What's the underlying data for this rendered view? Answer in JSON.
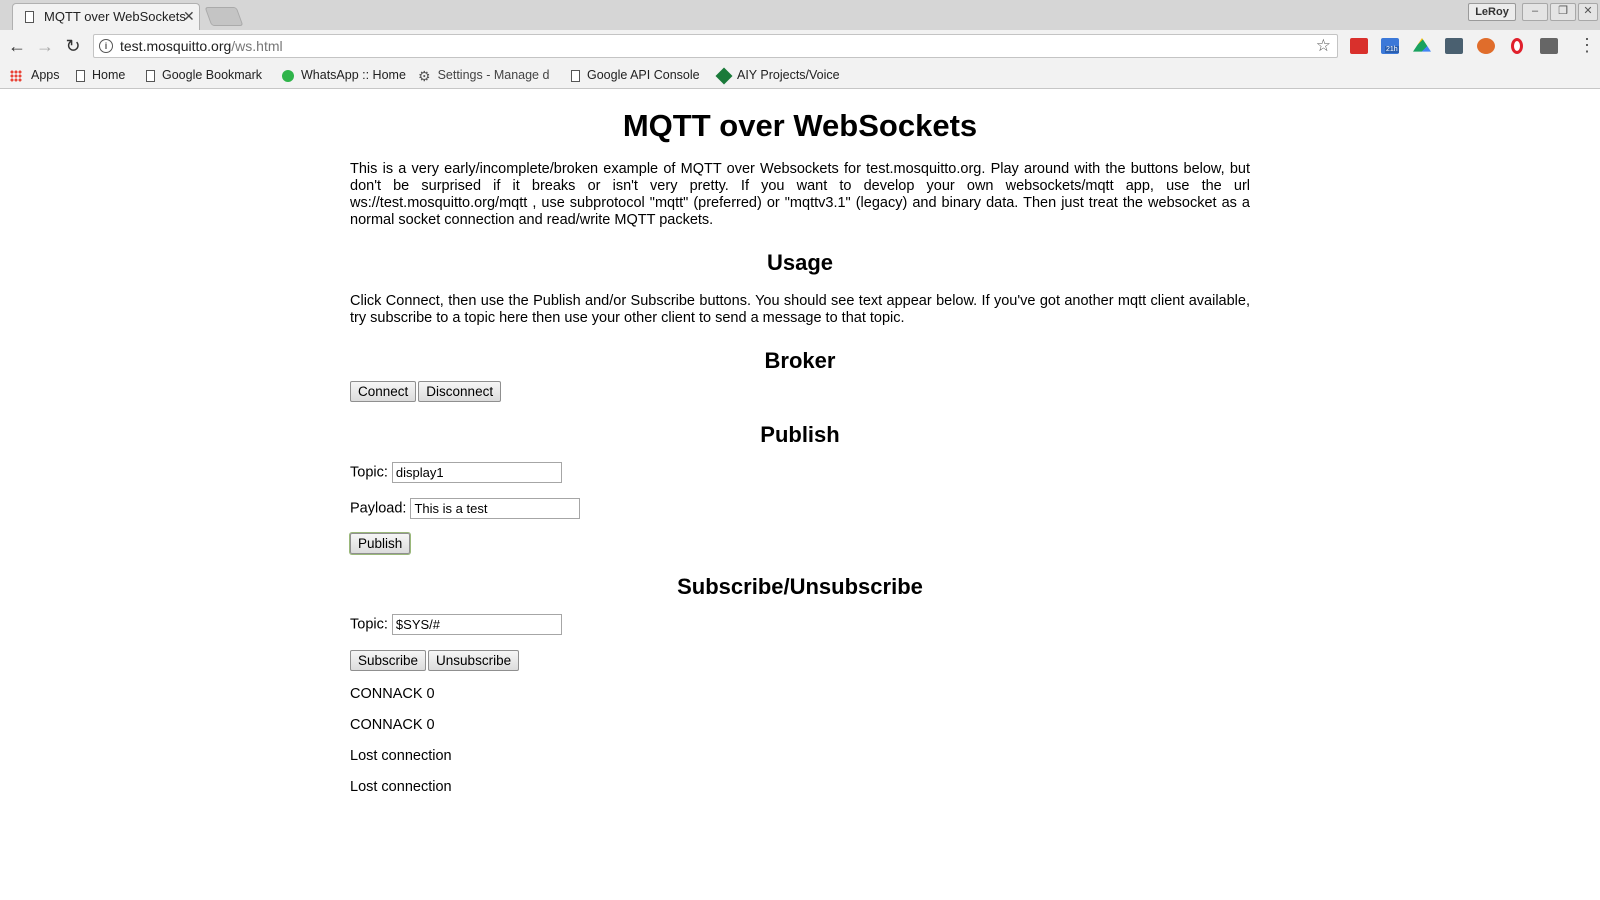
{
  "browser": {
    "tab_title": "MQTT over WebSockets",
    "user_label": "LeRoy",
    "url_host": "test.mosquitto.org",
    "url_path": "/ws.html",
    "bookmarks": [
      {
        "label": "Apps",
        "icon": "apps-grid-icon"
      },
      {
        "label": "Home",
        "icon": "page-icon"
      },
      {
        "label": "Google Bookmark",
        "icon": "page-icon"
      },
      {
        "label": "WhatsApp :: Home",
        "icon": "whatsapp-icon"
      },
      {
        "label": "Settings - Manage d",
        "icon": "gear-icon"
      },
      {
        "label": "Google API Console",
        "icon": "page-icon"
      },
      {
        "label": "AIY Projects/Voice",
        "icon": "aiy-icon"
      }
    ],
    "extension_badge": "21h"
  },
  "page": {
    "title": "MQTT over WebSockets",
    "intro": "This is a very early/incomplete/broken example of MQTT over Websockets for test.mosquitto.org. Play around with the buttons below, but don't be surprised if it breaks or isn't very pretty. If you want to develop your own websockets/mqtt app, use the url ws://test.mosquitto.org/mqtt , use subprotocol \"mqtt\" (preferred) or \"mqttv3.1\" (legacy) and binary data. Then just treat the websocket as a normal socket connection and read/write MQTT packets.",
    "usage": {
      "heading": "Usage",
      "text": "Click Connect, then use the Publish and/or Subscribe buttons. You should see text appear below. If you've got another mqtt client available, try subscribe to a topic here then use your other client to send a message to that topic."
    },
    "broker": {
      "heading": "Broker",
      "connect_label": "Connect",
      "disconnect_label": "Disconnect"
    },
    "publish": {
      "heading": "Publish",
      "topic_label": "Topic:",
      "topic_value": "display1",
      "payload_label": "Payload:",
      "payload_value": "This is a test",
      "button_label": "Publish"
    },
    "subscribe": {
      "heading": "Subscribe/Unsubscribe",
      "topic_label": "Topic:",
      "topic_value": "$SYS/#",
      "subscribe_label": "Subscribe",
      "unsubscribe_label": "Unsubscribe"
    },
    "log": [
      "CONNACK 0",
      "CONNACK 0",
      "Lost connection",
      "Lost connection"
    ]
  }
}
